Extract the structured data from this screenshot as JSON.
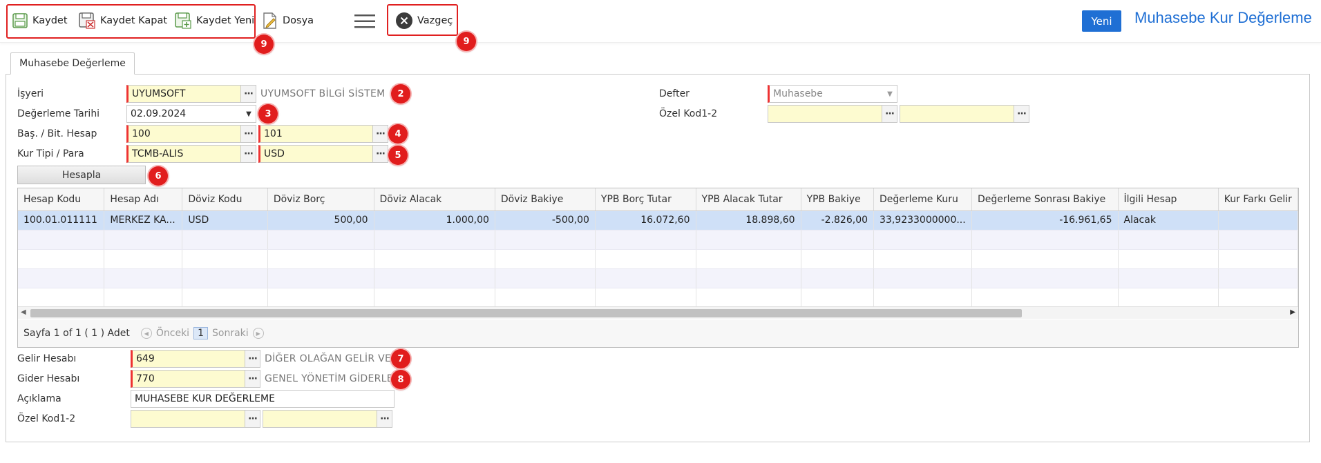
{
  "toolbar": {
    "save_label": "Kaydet",
    "save_close_label": "Kaydet Kapat",
    "save_new_label": "Kaydet Yeni",
    "file_label": "Dosya",
    "cancel_label": "Vazgeç",
    "new_label": "Yeni"
  },
  "page_title": "Muhasebe Kur Değerleme",
  "tab_label": "Muhasebe Değerleme",
  "badges": {
    "b1": "9",
    "b2": "9",
    "b3": "2",
    "b4": "3",
    "b5": "4",
    "b6": "5",
    "b7": "6",
    "b8": "7",
    "b9": "8"
  },
  "form": {
    "isyeri_label": "İşyeri",
    "isyeri_value": "UYUMSOFT",
    "isyeri_desc": "UYUMSOFT BİLGİ SİSTEM",
    "tarih_label": "Değerleme Tarihi",
    "tarih_value": "02.09.2024",
    "hesap_label": "Baş. / Bit. Hesap",
    "hesap_bas": "100",
    "hesap_bit": "101",
    "kur_label": "Kur Tipi / Para",
    "kur_tipi": "TCMB-ALIS",
    "para": "USD",
    "defter_label": "Defter",
    "defter_value": "Muhasebe",
    "ozelkod_label": "Özel Kod1-2",
    "hesapla_label": "Hesapla",
    "gelir_label": "Gelir Hesabı",
    "gelir_value": "649",
    "gelir_desc": "DİĞER OLAĞAN GELİR VE",
    "gider_label": "Gider Hesabı",
    "gider_value": "770",
    "gider_desc": "GENEL YÖNETİM GİDERLE",
    "aciklama_label": "Açıklama",
    "aciklama_value": "MUHASEBE KUR DEĞERLEME",
    "ozelkod2_label": "Özel Kod1-2"
  },
  "grid": {
    "columns": [
      "Hesap Kodu",
      "Hesap Adı",
      "Döviz Kodu",
      "Döviz Borç",
      "Döviz Alacak",
      "Döviz Bakiye",
      "YPB Borç Tutar",
      "YPB Alacak Tutar",
      "YPB Bakiye",
      "Değerleme Kuru",
      "Değerleme Sonrası Bakiye",
      "İlgili Hesap",
      "Kur Farkı Gelir"
    ],
    "row": [
      "100.01.011111",
      "MERKEZ KA...",
      "USD",
      "500,00",
      "1.000,00",
      "-500,00",
      "16.072,60",
      "18.898,60",
      "-2.826,00",
      "33,9233000000...",
      "-16.961,65",
      "Alacak",
      ""
    ]
  },
  "pager": {
    "text": "Sayfa 1 of 1 ( 1 ) Adet",
    "prev": "Önceki",
    "page": "1",
    "next": "Sonraki"
  }
}
